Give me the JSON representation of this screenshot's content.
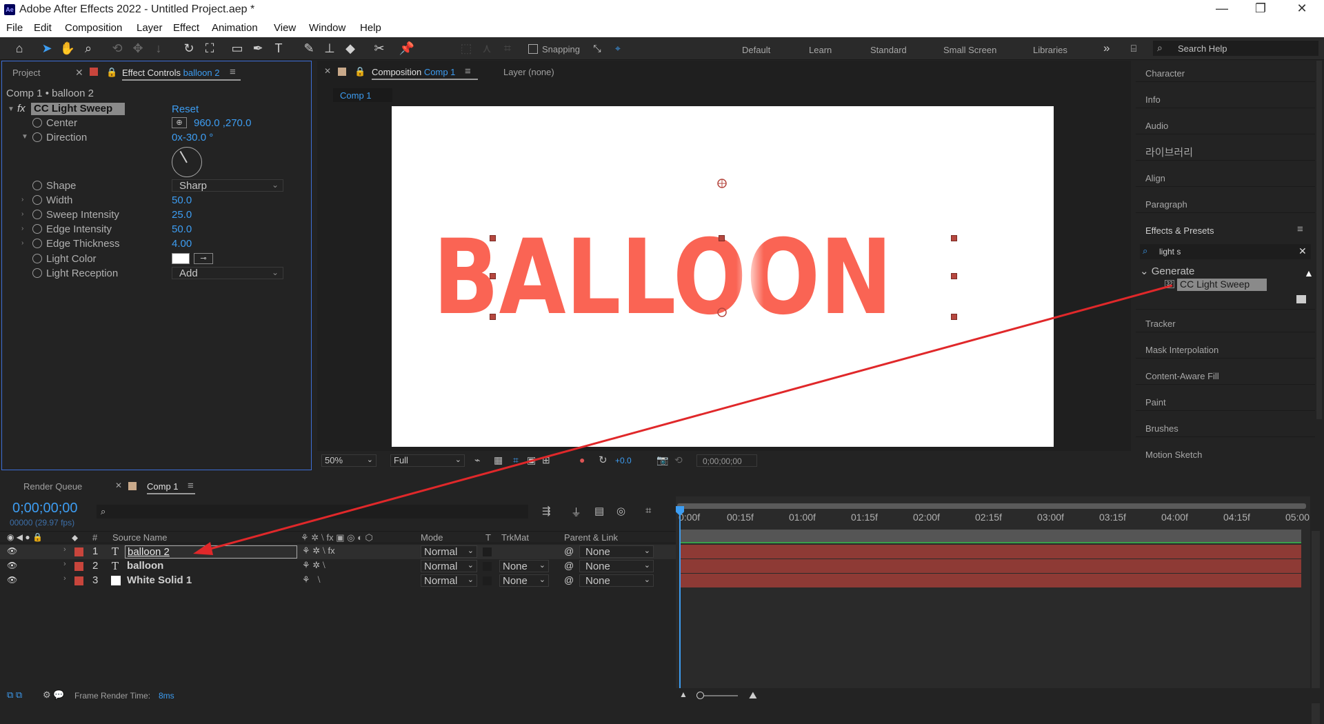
{
  "titlebar": {
    "app_badge": "Ae",
    "title": "Adobe After Effects 2022 - Untitled Project.aep *",
    "minimize": "—",
    "restore": "❐",
    "close": "✕"
  },
  "menu": [
    "File",
    "Edit",
    "Composition",
    "Layer",
    "Effect",
    "Animation",
    "View",
    "Window",
    "Help"
  ],
  "toolbar": {
    "snapping_label": "Snapping",
    "workspaces": [
      "Default",
      "Learn",
      "Standard",
      "Small Screen",
      "Libraries"
    ],
    "more": "»",
    "search_help": "Search Help"
  },
  "project_panel": {
    "tab_project": "Project",
    "tab_effect_controls": "Effect Controls",
    "tab_effect_controls_layer": "balloon 2",
    "breadcrumb": "Comp 1 • balloon 2"
  },
  "effect": {
    "name": "CC Light Sweep",
    "reset": "Reset",
    "fx": "fx",
    "center": {
      "label": "Center",
      "value": "960.0 ,270.0"
    },
    "direction": {
      "label": "Direction",
      "value": "0x-30.0 °"
    },
    "shape": {
      "label": "Shape",
      "value": "Sharp"
    },
    "width": {
      "label": "Width",
      "value": "50.0"
    },
    "sweep_intensity": {
      "label": "Sweep Intensity",
      "value": "25.0"
    },
    "edge_intensity": {
      "label": "Edge Intensity",
      "value": "50.0"
    },
    "edge_thickness": {
      "label": "Edge Thickness",
      "value": "4.00"
    },
    "light_color": {
      "label": "Light Color"
    },
    "light_reception": {
      "label": "Light Reception",
      "value": "Add"
    }
  },
  "composition_panel": {
    "tab_label": "Composition",
    "comp_name": "Comp 1",
    "layer_tab": "Layer (none)",
    "subtab": "Comp 1",
    "canvas_text": "BALLOON",
    "zoom": "50%",
    "resolution": "Full",
    "exposure": "+0.0",
    "timecode": "0;00;00;00"
  },
  "right_panel": {
    "items_top": [
      "Character",
      "Info",
      "Audio",
      "라이브러리",
      "Align",
      "Paragraph"
    ],
    "effects_presets": "Effects & Presets",
    "search_value": "light s",
    "category": "Generate",
    "result": "CC Light Sweep",
    "result_badge": "32",
    "items_bottom": [
      "Tracker",
      "Mask Interpolation",
      "Content-Aware Fill",
      "Paint",
      "Brushes",
      "Motion Sketch"
    ]
  },
  "timeline": {
    "tab_render": "Render Queue",
    "tab_comp": "Comp 1",
    "timecode": "0;00;00;00",
    "fps": "00000 (29.97 fps)",
    "columns": {
      "num": "#",
      "source": "Source Name",
      "mode": "Mode",
      "t": "T",
      "trkmat": "TrkMat",
      "parent": "Parent & Link"
    },
    "layers": [
      {
        "num": "1",
        "type": "T",
        "name": "balloon 2",
        "mode": "Normal",
        "trkmat": "",
        "parent": "None",
        "color": "#c8453c"
      },
      {
        "num": "2",
        "type": "T",
        "name": "balloon",
        "mode": "Normal",
        "trkmat": "None",
        "parent": "None",
        "color": "#c8453c"
      },
      {
        "num": "3",
        "type": "",
        "name": "White Solid 1",
        "mode": "Normal",
        "trkmat": "None",
        "parent": "None",
        "color": "#c8453c"
      }
    ],
    "ruler": [
      "0:00f",
      "00:15f",
      "01:00f",
      "01:15f",
      "02:00f",
      "02:15f",
      "03:00f",
      "03:15f",
      "04:00f",
      "04:15f",
      "05:00"
    ],
    "frame_render_label": "Frame Render Time:",
    "frame_render_value": "8ms"
  },
  "colors": {
    "accent": "#3d9df2",
    "text_red": "#fa6454",
    "arrow": "#e0282a",
    "layer_bar": "#8e3a35"
  }
}
